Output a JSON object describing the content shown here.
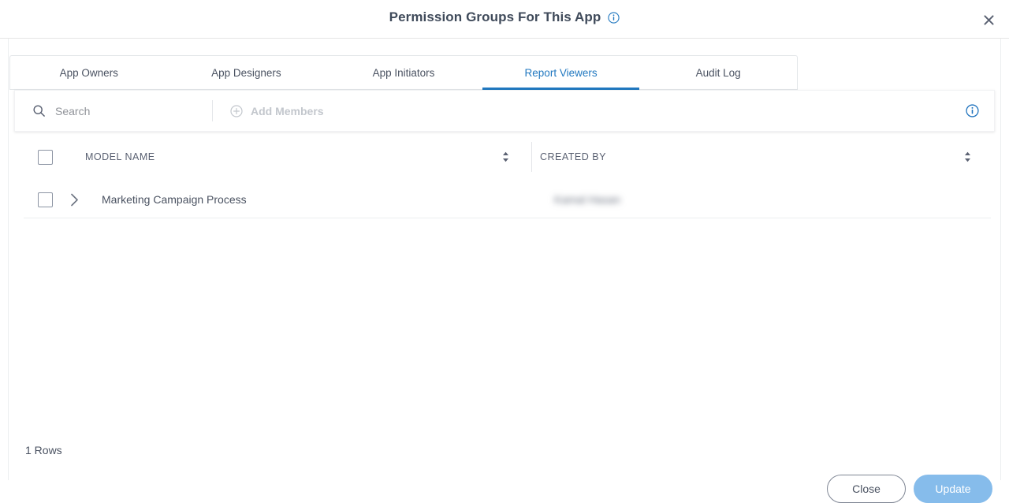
{
  "dialog": {
    "title": "Permission Groups For This App",
    "title_info_icon": "info-icon",
    "close_icon": "close-icon"
  },
  "tabs": [
    {
      "label": "App Owners",
      "active": false
    },
    {
      "label": "App Designers",
      "active": false
    },
    {
      "label": "App Initiators",
      "active": false
    },
    {
      "label": "Report Viewers",
      "active": true
    },
    {
      "label": "Audit Log",
      "active": false
    }
  ],
  "toolbar": {
    "search_placeholder": "Search",
    "search_value": "",
    "search_icon": "search-icon",
    "add_members_label": "Add Members",
    "add_members_icon": "plus-circle-icon",
    "info_icon": "info-icon"
  },
  "table": {
    "columns": [
      {
        "label": "MODEL NAME",
        "sortable": true
      },
      {
        "label": "CREATED BY",
        "sortable": true
      }
    ],
    "rows": [
      {
        "model_name": "Marketing Campaign Process",
        "created_by": "Kamal Hasan",
        "created_by_redacted": true,
        "expand_icon": "chevron-right-icon"
      }
    ],
    "rows_count_label": "1 Rows"
  },
  "footer": {
    "close_label": "Close",
    "update_label": "Update"
  },
  "colors": {
    "accent_blue": "#2178c0",
    "update_button": "#86bceb",
    "text": "#4a5261",
    "muted": "#909399",
    "disabled": "#c3c7cd",
    "border": "#eceef0"
  }
}
